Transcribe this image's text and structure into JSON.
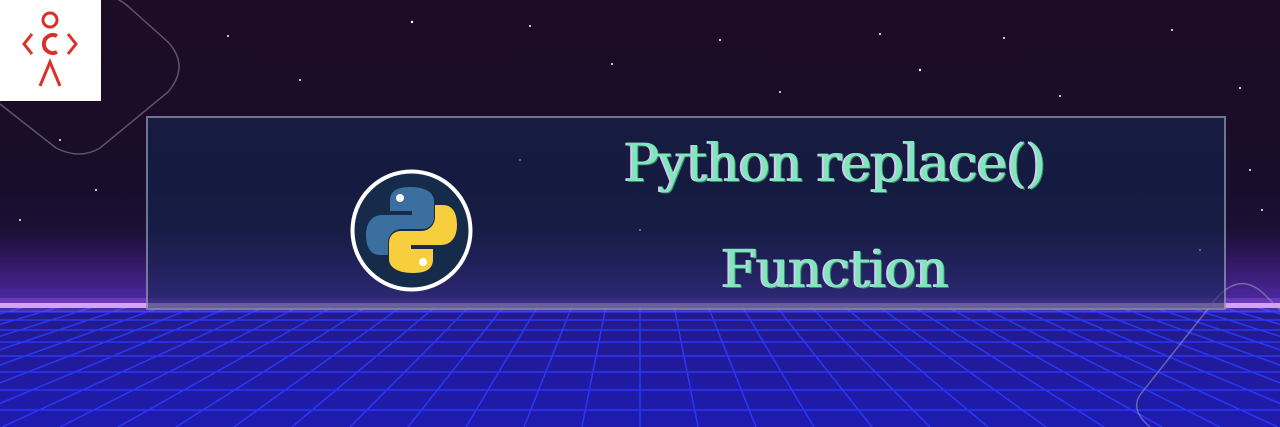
{
  "banner": {
    "title_line_1": "Python replace()",
    "title_line_2": "Function"
  },
  "logos": {
    "brand_mark_text": "<C>",
    "python_logo": "python-logo"
  },
  "colors": {
    "title_text": "#7ee8ba",
    "horizon_glow": "#d9a8ff",
    "grid_lines": "#2b3bff",
    "brand_red": "#d9302a",
    "python_blue": "#3b6fa0",
    "python_yellow": "#f7cf3d"
  }
}
